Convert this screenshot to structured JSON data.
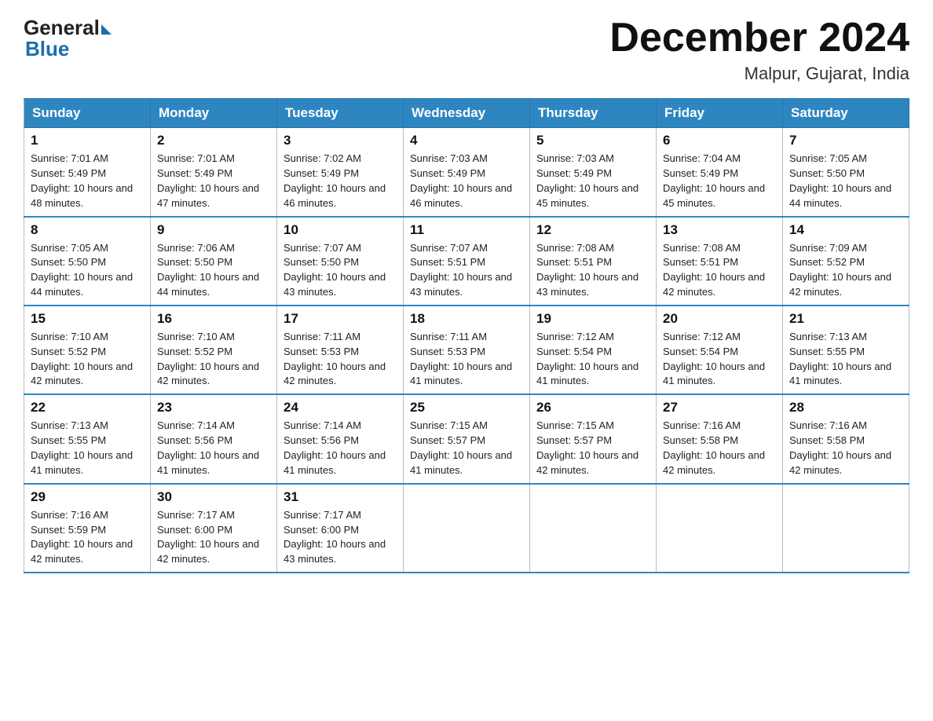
{
  "header": {
    "logo_general": "General",
    "logo_blue": "Blue",
    "month_title": "December 2024",
    "location": "Malpur, Gujarat, India"
  },
  "days_of_week": [
    "Sunday",
    "Monday",
    "Tuesday",
    "Wednesday",
    "Thursday",
    "Friday",
    "Saturday"
  ],
  "weeks": [
    [
      {
        "day": "1",
        "sunrise": "7:01 AM",
        "sunset": "5:49 PM",
        "daylight": "10 hours and 48 minutes."
      },
      {
        "day": "2",
        "sunrise": "7:01 AM",
        "sunset": "5:49 PM",
        "daylight": "10 hours and 47 minutes."
      },
      {
        "day": "3",
        "sunrise": "7:02 AM",
        "sunset": "5:49 PM",
        "daylight": "10 hours and 46 minutes."
      },
      {
        "day": "4",
        "sunrise": "7:03 AM",
        "sunset": "5:49 PM",
        "daylight": "10 hours and 46 minutes."
      },
      {
        "day": "5",
        "sunrise": "7:03 AM",
        "sunset": "5:49 PM",
        "daylight": "10 hours and 45 minutes."
      },
      {
        "day": "6",
        "sunrise": "7:04 AM",
        "sunset": "5:49 PM",
        "daylight": "10 hours and 45 minutes."
      },
      {
        "day": "7",
        "sunrise": "7:05 AM",
        "sunset": "5:50 PM",
        "daylight": "10 hours and 44 minutes."
      }
    ],
    [
      {
        "day": "8",
        "sunrise": "7:05 AM",
        "sunset": "5:50 PM",
        "daylight": "10 hours and 44 minutes."
      },
      {
        "day": "9",
        "sunrise": "7:06 AM",
        "sunset": "5:50 PM",
        "daylight": "10 hours and 44 minutes."
      },
      {
        "day": "10",
        "sunrise": "7:07 AM",
        "sunset": "5:50 PM",
        "daylight": "10 hours and 43 minutes."
      },
      {
        "day": "11",
        "sunrise": "7:07 AM",
        "sunset": "5:51 PM",
        "daylight": "10 hours and 43 minutes."
      },
      {
        "day": "12",
        "sunrise": "7:08 AM",
        "sunset": "5:51 PM",
        "daylight": "10 hours and 43 minutes."
      },
      {
        "day": "13",
        "sunrise": "7:08 AM",
        "sunset": "5:51 PM",
        "daylight": "10 hours and 42 minutes."
      },
      {
        "day": "14",
        "sunrise": "7:09 AM",
        "sunset": "5:52 PM",
        "daylight": "10 hours and 42 minutes."
      }
    ],
    [
      {
        "day": "15",
        "sunrise": "7:10 AM",
        "sunset": "5:52 PM",
        "daylight": "10 hours and 42 minutes."
      },
      {
        "day": "16",
        "sunrise": "7:10 AM",
        "sunset": "5:52 PM",
        "daylight": "10 hours and 42 minutes."
      },
      {
        "day": "17",
        "sunrise": "7:11 AM",
        "sunset": "5:53 PM",
        "daylight": "10 hours and 42 minutes."
      },
      {
        "day": "18",
        "sunrise": "7:11 AM",
        "sunset": "5:53 PM",
        "daylight": "10 hours and 41 minutes."
      },
      {
        "day": "19",
        "sunrise": "7:12 AM",
        "sunset": "5:54 PM",
        "daylight": "10 hours and 41 minutes."
      },
      {
        "day": "20",
        "sunrise": "7:12 AM",
        "sunset": "5:54 PM",
        "daylight": "10 hours and 41 minutes."
      },
      {
        "day": "21",
        "sunrise": "7:13 AM",
        "sunset": "5:55 PM",
        "daylight": "10 hours and 41 minutes."
      }
    ],
    [
      {
        "day": "22",
        "sunrise": "7:13 AM",
        "sunset": "5:55 PM",
        "daylight": "10 hours and 41 minutes."
      },
      {
        "day": "23",
        "sunrise": "7:14 AM",
        "sunset": "5:56 PM",
        "daylight": "10 hours and 41 minutes."
      },
      {
        "day": "24",
        "sunrise": "7:14 AM",
        "sunset": "5:56 PM",
        "daylight": "10 hours and 41 minutes."
      },
      {
        "day": "25",
        "sunrise": "7:15 AM",
        "sunset": "5:57 PM",
        "daylight": "10 hours and 41 minutes."
      },
      {
        "day": "26",
        "sunrise": "7:15 AM",
        "sunset": "5:57 PM",
        "daylight": "10 hours and 42 minutes."
      },
      {
        "day": "27",
        "sunrise": "7:16 AM",
        "sunset": "5:58 PM",
        "daylight": "10 hours and 42 minutes."
      },
      {
        "day": "28",
        "sunrise": "7:16 AM",
        "sunset": "5:58 PM",
        "daylight": "10 hours and 42 minutes."
      }
    ],
    [
      {
        "day": "29",
        "sunrise": "7:16 AM",
        "sunset": "5:59 PM",
        "daylight": "10 hours and 42 minutes."
      },
      {
        "day": "30",
        "sunrise": "7:17 AM",
        "sunset": "6:00 PM",
        "daylight": "10 hours and 42 minutes."
      },
      {
        "day": "31",
        "sunrise": "7:17 AM",
        "sunset": "6:00 PM",
        "daylight": "10 hours and 43 minutes."
      },
      null,
      null,
      null,
      null
    ]
  ],
  "labels": {
    "sunrise_prefix": "Sunrise: ",
    "sunset_prefix": "Sunset: ",
    "daylight_prefix": "Daylight: "
  }
}
